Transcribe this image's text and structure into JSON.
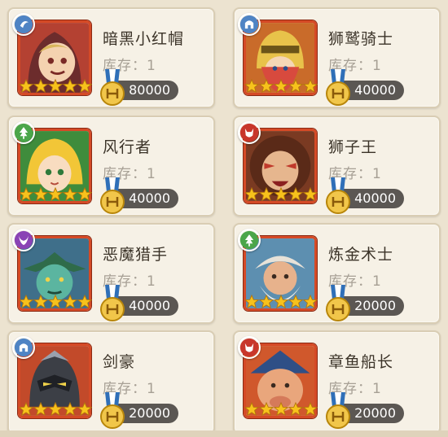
{
  "stock_label": "库存：",
  "heroes": [
    {
      "name": "暗黑小红帽",
      "stock": "1",
      "price": "80000",
      "faction": "moon-faction-icon",
      "faction_color": "#4f84c4",
      "stars": 5
    },
    {
      "name": "狮鹫骑士",
      "stock": "1",
      "price": "40000",
      "faction": "helmet-faction-icon",
      "faction_color": "#4f84c4",
      "stars": 5
    },
    {
      "name": "风行者",
      "stock": "1",
      "price": "40000",
      "faction": "tree-faction-icon",
      "faction_color": "#4ba64a",
      "stars": 5
    },
    {
      "name": "狮子王",
      "stock": "1",
      "price": "40000",
      "faction": "demon-faction-icon",
      "faction_color": "#c8362b",
      "stars": 5
    },
    {
      "name": "恶魔猎手",
      "stock": "1",
      "price": "40000",
      "faction": "horns-faction-icon",
      "faction_color": "#8a43b5",
      "stars": 5
    },
    {
      "name": "炼金术士",
      "stock": "1",
      "price": "20000",
      "faction": "tree-faction-icon",
      "faction_color": "#4ba64a",
      "stars": 5
    },
    {
      "name": "剑豪",
      "stock": "1",
      "price": "20000",
      "faction": "helmet-faction-icon",
      "faction_color": "#4f84c4",
      "stars": 5
    },
    {
      "name": "章鱼船长",
      "stock": "1",
      "price": "20000",
      "faction": "demon-faction-icon",
      "faction_color": "#c8362b",
      "stars": 5
    }
  ],
  "colors": {
    "card_bg": "#f6f1e6",
    "frame": "#d54a26",
    "price_pill": "#5b5753",
    "star": "#f7c21c",
    "medal_blue": "#2f6fb8",
    "medal_gold": "#f1c64a"
  }
}
